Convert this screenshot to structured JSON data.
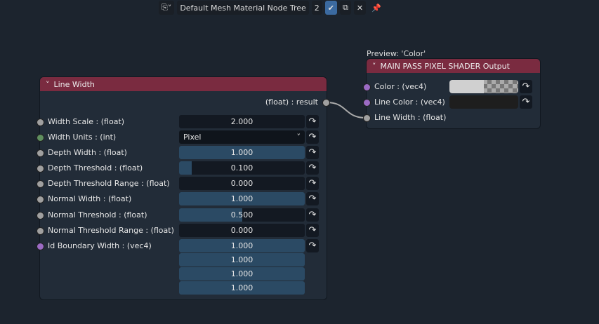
{
  "topbar": {
    "editor_icon": "node-editor-icon",
    "tree_name": "Default Mesh Material Node Tree",
    "users": "2"
  },
  "line_width_node": {
    "title": "Line Width",
    "output": "(float) : result",
    "inputs": [
      {
        "label": "Width Scale : (float)",
        "value": "2.000",
        "fill": 0,
        "socket": "#a0a0a0"
      },
      {
        "label": "Width Units : (int)",
        "value": "Pixel",
        "type": "dropdown",
        "socket": "#5f8f5f"
      },
      {
        "label": "Depth Width : (float)",
        "value": "1.000",
        "fill": 1,
        "socket": "#a0a0a0"
      },
      {
        "label": "Depth Threshold : (float)",
        "value": "0.100",
        "fill": 0.1,
        "socket": "#a0a0a0"
      },
      {
        "label": "Depth Threshold Range : (float)",
        "value": "0.000",
        "fill": 0,
        "socket": "#a0a0a0"
      },
      {
        "label": "Normal Width : (float)",
        "value": "1.000",
        "fill": 1,
        "socket": "#a0a0a0"
      },
      {
        "label": "Normal Threshold : (float)",
        "value": "0.500",
        "fill": 0.5,
        "socket": "#a0a0a0"
      },
      {
        "label": "Normal Threshold Range : (float)",
        "value": "0.000",
        "fill": 0,
        "socket": "#a0a0a0"
      },
      {
        "label": "Id Boundary Width : (vec4)",
        "value": "1.000",
        "fill": 1,
        "socket": "#9b6bc4",
        "extra": [
          "1.000",
          "1.000",
          "1.000"
        ]
      }
    ]
  },
  "output_node": {
    "preview": "Preview: 'Color'",
    "title": "MAIN PASS PIXEL SHADER Output",
    "inputs": [
      {
        "label": "Color : (vec4)"
      },
      {
        "label": "Line Color : (vec4)"
      },
      {
        "label": "Line Width : (float)"
      }
    ]
  }
}
